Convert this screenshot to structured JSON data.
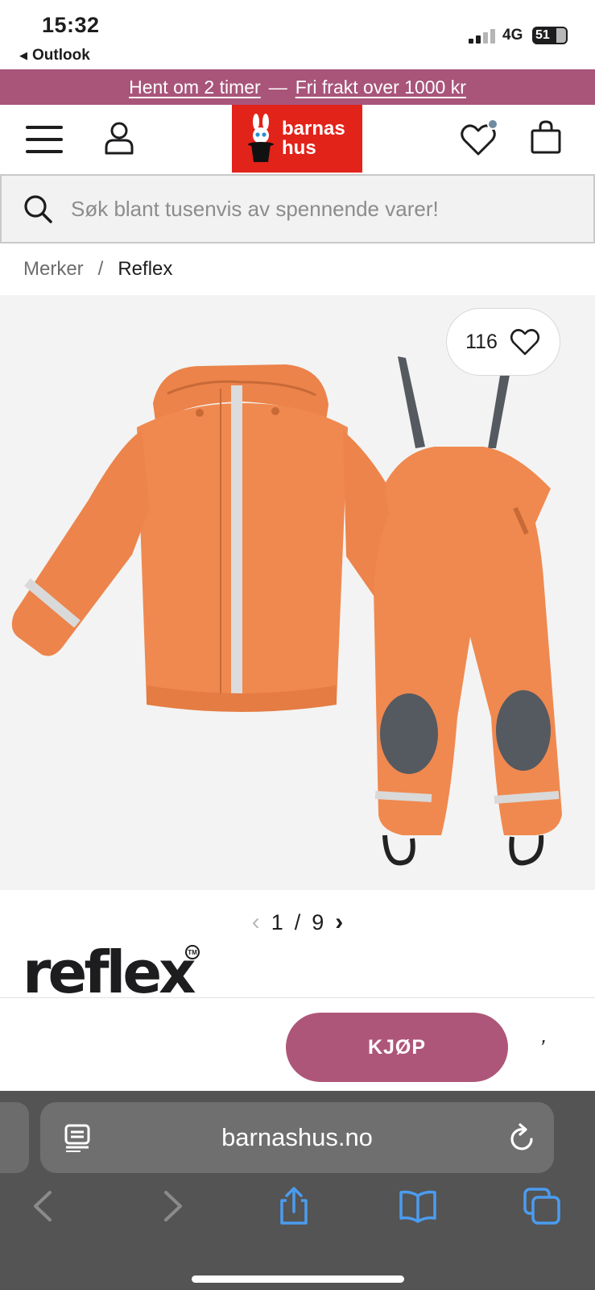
{
  "status_bar": {
    "time": "15:32",
    "back_app": "Outlook",
    "network": "4G",
    "battery": "51"
  },
  "promo": {
    "left_link": "Hent om 2 timer",
    "separator": "—",
    "right_link": "Fri frakt over 1000 kr"
  },
  "header": {
    "logo_line1": "barnas",
    "logo_line2": "hus"
  },
  "search": {
    "placeholder": "Søk blant tusenvis av spennende varer!"
  },
  "breadcrumb": {
    "parent": "Merker",
    "separator": "/",
    "current": "Reflex"
  },
  "gallery": {
    "favorite_count": "116",
    "current_page": "1",
    "page_separator": "/",
    "total_pages": "9"
  },
  "brand": {
    "name": "reflex",
    "trademark": "TM"
  },
  "buy_bar": {
    "buy_label": "KJØP",
    "trailing_mark": "’"
  },
  "browser": {
    "url": "barnashus.no"
  },
  "colors": {
    "promo_bg": "#a9557a",
    "buy_button": "#ae5679",
    "logo_red": "#e2231a",
    "product_orange": "#f0894f"
  },
  "icons": [
    "hamburger-icon",
    "user-icon",
    "heart-icon",
    "bag-icon",
    "search-icon",
    "chevron-left-icon",
    "chevron-right-icon",
    "reader-icon",
    "reload-icon",
    "back-icon",
    "forward-icon",
    "share-icon",
    "bookmarks-icon",
    "tabs-icon"
  ]
}
